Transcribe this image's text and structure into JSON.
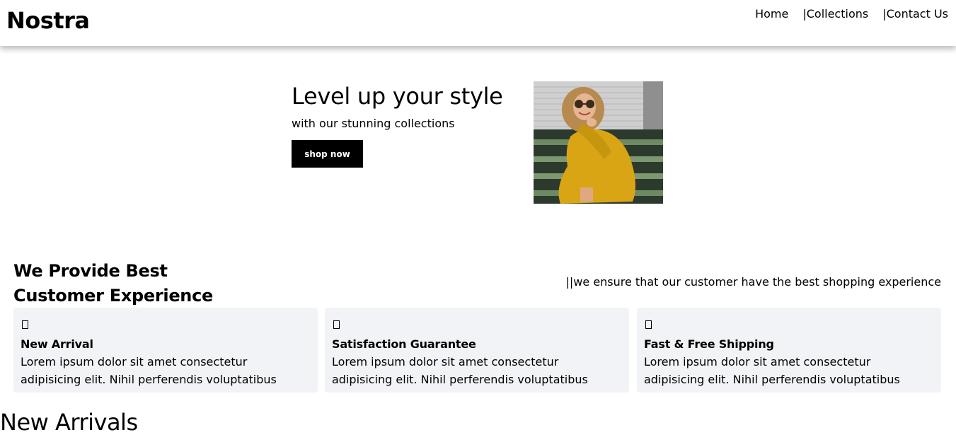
{
  "nav": {
    "logo": "Nostra",
    "links": [
      "Home",
      "|Collections",
      "|Contact Us"
    ]
  },
  "hero": {
    "title": "Level up your style",
    "subtitle": "with our stunning collections",
    "button_label": "shop now",
    "image": "woman-in-yellow-dress-photo"
  },
  "features": {
    "title_line1": "We Provide Best",
    "title_line2": "Customer Experience",
    "tagline": "||we ensure that our customer have the best shopping experience",
    "cards": [
      {
        "icon": "missing-glyph-icon",
        "title": "New Arrival",
        "line1": "Lorem ipsum dolor sit amet consectetur",
        "line2": "adipisicing elit. Nihil perferendis voluptatibus"
      },
      {
        "icon": "missing-glyph-icon",
        "title": "Satisfaction Guarantee",
        "line1": "Lorem ipsum dolor sit amet consectetur",
        "line2": "adipisicing elit. Nihil perferendis voluptatibus"
      },
      {
        "icon": "missing-glyph-icon",
        "title": "Fast & Free Shipping",
        "line1": "Lorem ipsum dolor sit amet consectetur",
        "line2": "adipisicing elit. Nihil perferendis voluptatibus"
      }
    ]
  },
  "arrivals": {
    "title": "New Arrivals"
  },
  "colors": {
    "card_bg": "#f2f3f6",
    "button_bg": "#000000",
    "dress": "#d9a514"
  }
}
